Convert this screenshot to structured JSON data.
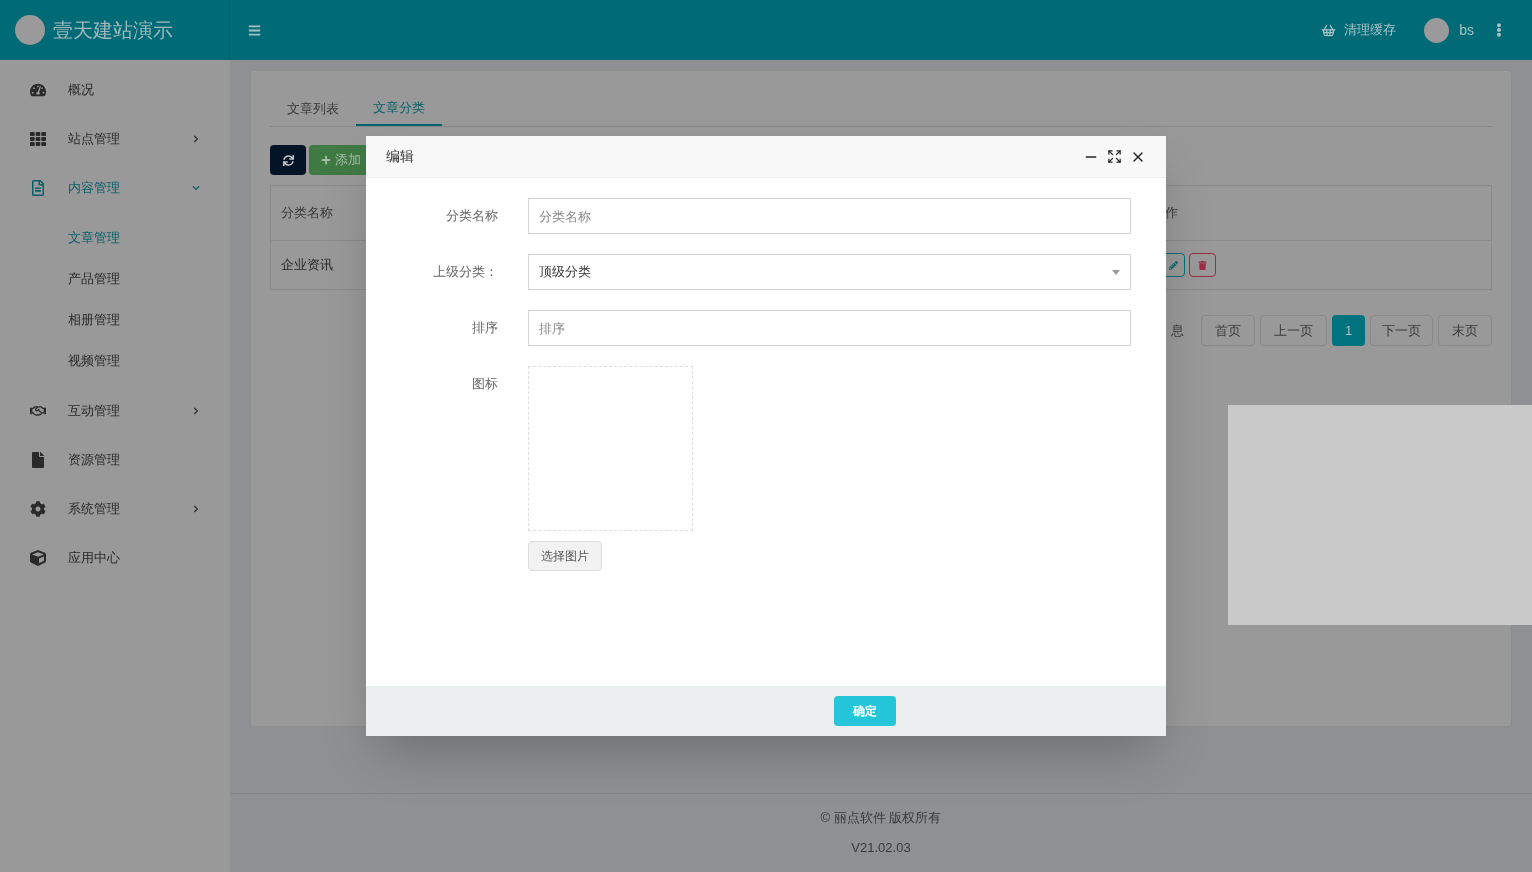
{
  "header": {
    "brand": "壹天建站演示",
    "clear_cache": "清理缓存",
    "user": "bs"
  },
  "sidebar": {
    "items": [
      {
        "kind": "dashboard",
        "label": "概况",
        "submenu": false,
        "expanded": false
      },
      {
        "kind": "grid",
        "label": "站点管理",
        "submenu": true,
        "expanded": false
      },
      {
        "kind": "document",
        "label": "内容管理",
        "submenu": true,
        "expanded": true,
        "children": [
          {
            "label": "文章管理",
            "selected": true
          },
          {
            "label": "产品管理",
            "selected": false
          },
          {
            "label": "相册管理",
            "selected": false
          },
          {
            "label": "视频管理",
            "selected": false
          }
        ]
      },
      {
        "kind": "handshake",
        "label": "互动管理",
        "submenu": true,
        "expanded": false
      },
      {
        "kind": "file",
        "label": "资源管理",
        "submenu": false,
        "expanded": false
      },
      {
        "kind": "gear",
        "label": "系统管理",
        "submenu": true,
        "expanded": false
      },
      {
        "kind": "cube",
        "label": "应用中心",
        "submenu": false,
        "expanded": false
      }
    ]
  },
  "tabs": [
    {
      "label": "文章列表",
      "selected": false
    },
    {
      "label": "文章分类",
      "selected": true
    }
  ],
  "toolbar": {
    "add": "添加"
  },
  "table": {
    "columns": [
      "分类名称",
      "作"
    ],
    "rows": [
      [
        "企业资讯"
      ]
    ]
  },
  "pagination": {
    "info": "息",
    "first": "首页",
    "prev": "上一页",
    "pages": [
      {
        "label": "1",
        "selected": true
      }
    ],
    "next": "下一页",
    "last": "末页"
  },
  "footer": {
    "copyright": "© 丽点软件 版权所有",
    "version": "V21.02.03"
  },
  "dialog": {
    "title": "编辑",
    "fields": [
      {
        "kind": "text",
        "label": "分类名称",
        "placeholder": "分类名称"
      },
      {
        "kind": "select",
        "label": "上级分类：",
        "value": "顶级分类"
      },
      {
        "kind": "text",
        "label": "排序",
        "placeholder": "排序"
      },
      {
        "kind": "image",
        "label": "图标",
        "button": "选择图片"
      }
    ],
    "confirm": "确定"
  }
}
